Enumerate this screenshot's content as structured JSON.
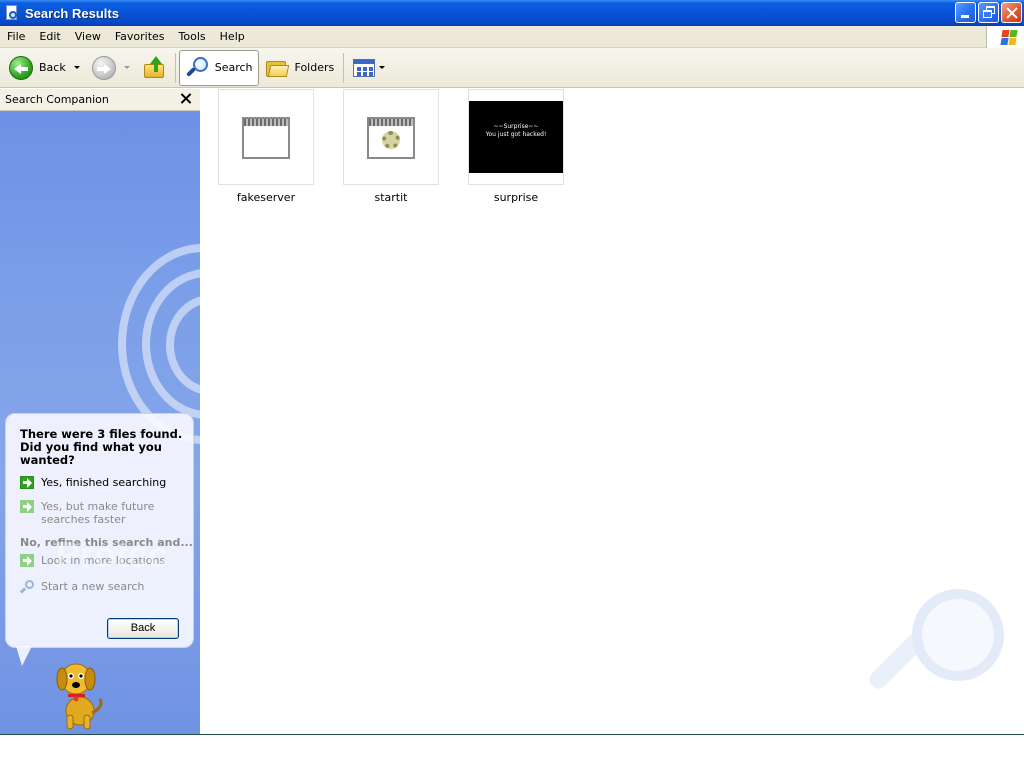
{
  "window": {
    "title": "Search Results"
  },
  "menu": {
    "items": [
      "File",
      "Edit",
      "View",
      "Favorites",
      "Tools",
      "Help"
    ]
  },
  "toolbar": {
    "back_label": "Back",
    "search_label": "Search",
    "folders_label": "Folders"
  },
  "search_companion": {
    "title": "Search Companion",
    "watermark": "Protec",
    "question": "There were 3 files found. Did you find what you wanted?",
    "options": [
      "Yes, finished searching",
      "Yes, but make future searches faster"
    ],
    "refine_label": "No, refine this search and...",
    "more_locations": "Look in more locations",
    "new_search": "Start a new search",
    "back_button": "Back"
  },
  "files": [
    {
      "name": "fakeserver",
      "icon": "window-icon"
    },
    {
      "name": "startit",
      "icon": "window-gear-icon"
    },
    {
      "name": "surprise",
      "icon": "image-thumbnail",
      "preview_line1": "~~Surprise~~",
      "preview_line2": "You just got hacked!"
    }
  ],
  "colors": {
    "titlebar": "#0a53d6",
    "pane": "#7a9ee8",
    "menu_bg": "#ece9d8"
  }
}
